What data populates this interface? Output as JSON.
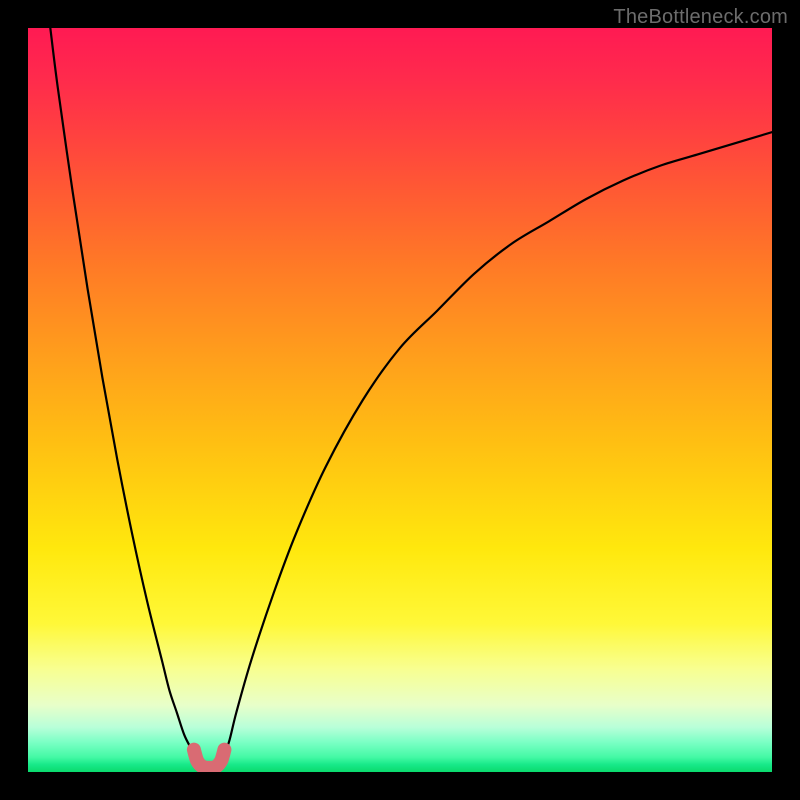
{
  "watermark": "TheBottleneck.com",
  "colors": {
    "frame": "#000000",
    "curve_stroke": "#000000",
    "knee_marker": "#d96b73"
  },
  "chart_data": {
    "type": "line",
    "title": "",
    "xlabel": "",
    "ylabel": "",
    "xlim": [
      0,
      100
    ],
    "ylim": [
      0,
      100
    ],
    "series": [
      {
        "name": "left-branch",
        "x": [
          3,
          4,
          6,
          8,
          10,
          12,
          14,
          16,
          18,
          19,
          20,
          21,
          22,
          22.7
        ],
        "values": [
          100,
          92,
          78,
          65,
          53,
          42,
          32,
          23,
          15,
          11,
          8,
          5,
          3,
          1.5
        ]
      },
      {
        "name": "right-branch",
        "x": [
          26.0,
          27,
          28,
          30,
          33,
          36,
          40,
          45,
          50,
          55,
          60,
          65,
          70,
          75,
          80,
          85,
          90,
          95,
          100
        ],
        "values": [
          1.5,
          4,
          8,
          15,
          24,
          32,
          41,
          50,
          57,
          62,
          67,
          71,
          74,
          77,
          79.5,
          81.5,
          83,
          84.5,
          86
        ]
      },
      {
        "name": "knee-marker",
        "x": [
          22.3,
          22.7,
          23.2,
          23.8,
          24.4,
          25.0,
          25.5,
          26.0,
          26.4
        ],
        "values": [
          3.0,
          1.6,
          0.9,
          0.6,
          0.55,
          0.6,
          0.9,
          1.6,
          3.0
        ]
      }
    ],
    "optimum_x": 24.4
  }
}
